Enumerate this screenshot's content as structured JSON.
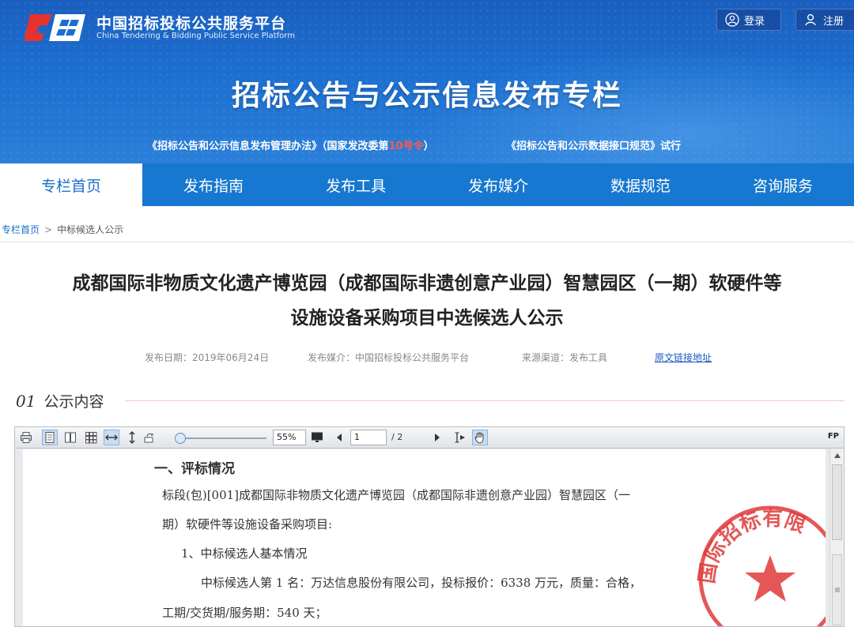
{
  "header": {
    "site_name": "中国招标投标公共服务平台",
    "site_name_en": "China Tendering & Bidding Public Service Platform",
    "login_label": "登录",
    "register_label": "注册",
    "banner_title": "招标公告与公示信息发布专栏",
    "sub_left_prefix": "《招标公告和公示信息发布管理办法》（国家发改委第",
    "sub_left_highlight": "10号令",
    "sub_left_suffix": "）",
    "sub_right": "《招标公告和公示数据接口规范》试行",
    "colors": {
      "banner": "#1c6fd0",
      "highlight": "#ff5a4a"
    }
  },
  "nav": {
    "items": [
      {
        "label": "专栏首页"
      },
      {
        "label": "发布指南"
      },
      {
        "label": "发布工具"
      },
      {
        "label": "发布媒介"
      },
      {
        "label": "数据规范"
      },
      {
        "label": "咨询服务"
      }
    ],
    "active_index": 0,
    "color": "#1678d0"
  },
  "breadcrumb": {
    "home": "专栏首页",
    "separator": ">",
    "current": "中标候选人公示"
  },
  "article": {
    "title_line1": "成都国际非物质文化遗产博览园（成都国际非遗创意产业园）智慧园区（一期）软硬件等",
    "title_line2": "设施设备采购项目中选候选人公示",
    "publish_date": "发布日期：2019年06月24日",
    "publish_media": "发布媒介：中国招标投标公共服务平台",
    "source_channel": "来源渠道：发布工具",
    "original_link": "原文链接地址",
    "section_number": "01",
    "section_label": "公示内容"
  },
  "viewer": {
    "zoom": "55%",
    "page_current": "1",
    "page_total": "/ 2",
    "fp_label": "FP",
    "doc": {
      "heading": "一、评标情况",
      "line1": "标段(包)[001]成都国际非物质文化遗产博览园（成都国际非遗创意产业园）智慧园区（一",
      "line2": "期）软硬件等设施设备采购项目:",
      "line3": "1、中标候选人基本情况",
      "line4": "中标候选人第 1 名：万达信息股份有限公司，投标报价：6338 万元，质量：合格，",
      "line5": "工期/交货期/服务期：540 天；"
    },
    "stamp_text": "国际招标有限"
  }
}
